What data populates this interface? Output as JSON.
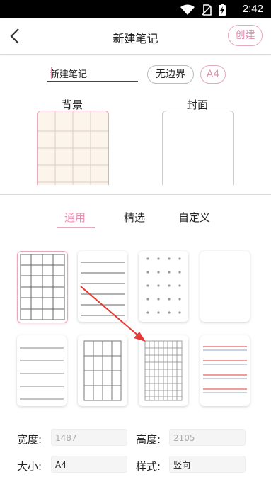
{
  "status_bar": {
    "time": "2:42",
    "icons": [
      "wifi-icon",
      "no-sim-icon",
      "battery-charging-icon"
    ]
  },
  "header": {
    "title": "新建笔记",
    "create_label": "创建",
    "back_icon": "chevron-left-icon"
  },
  "note": {
    "name_value": "新建笔记",
    "border_chip": "无边界",
    "size_chip": "A4"
  },
  "previews": {
    "background_label": "背景",
    "cover_label": "封面"
  },
  "tabs": [
    {
      "label": "通用",
      "active": true
    },
    {
      "label": "精选",
      "active": false
    },
    {
      "label": "自定义",
      "active": false
    }
  ],
  "templates": [
    {
      "pattern": "grid",
      "selected": true
    },
    {
      "pattern": "ruled-lines",
      "selected": false
    },
    {
      "pattern": "dots",
      "selected": false
    },
    {
      "pattern": "blank",
      "selected": false
    },
    {
      "pattern": "wide-ruled",
      "selected": false
    },
    {
      "pattern": "large-grid",
      "selected": false
    },
    {
      "pattern": "fine-grid",
      "selected": false
    },
    {
      "pattern": "red-blue-lines",
      "selected": false
    }
  ],
  "fields": {
    "width_label": "宽度:",
    "width_placeholder": "1487",
    "height_label": "高度:",
    "height_placeholder": "2105",
    "size_label": "大小:",
    "size_value": "A4",
    "style_label": "样式:",
    "style_value": "竖向"
  },
  "colors": {
    "accent": "#e58fb1",
    "annotation_arrow": "#e53935"
  }
}
